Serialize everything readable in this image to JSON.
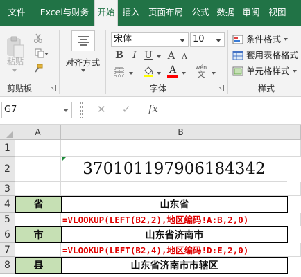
{
  "ribbon_tabs": [
    "文件",
    "Excel与财务",
    "开始",
    "插入",
    "页面布局",
    "公式",
    "数据",
    "审阅",
    "视图"
  ],
  "active_tab": "开始",
  "clipboard": {
    "paste_label": "粘贴",
    "group_label": "剪贴板"
  },
  "alignment": {
    "label": "对齐方式"
  },
  "font": {
    "name": "宋体",
    "size": "10",
    "group_label": "字体",
    "bold": "B",
    "italic": "I",
    "underline": "U",
    "grow": "A",
    "shrink": "A",
    "color_a": "A",
    "phonetic": "wén"
  },
  "styles": {
    "conditional_format": "条件格式",
    "table_format": "套用表格格式",
    "cell_style": "单元格样式",
    "group_label": "样式"
  },
  "colors": {
    "brand": "#217346",
    "highlight": "#ffff00",
    "font_color": "#ff0000",
    "label_fill": "#c6e0b4",
    "formula_text": "#e00000"
  },
  "formula_bar": {
    "name_box": "G7",
    "cancel_icon": "✕",
    "enter_icon": "✓",
    "fx": "fx",
    "content": ""
  },
  "sheet": {
    "columns": [
      "A",
      "B"
    ],
    "rows": [
      "1",
      "2",
      "3",
      "4",
      "5",
      "6",
      "7",
      "8"
    ],
    "id_number": "370101197906184342",
    "province_label": "省",
    "province_value": "山东省",
    "province_formula": "=VLOOKUP(LEFT(B2,2),地区编码!A:B,2,0)",
    "city_label": "市",
    "city_value": "山东省济南市",
    "city_formula": "=VLOOKUP(LEFT(B2,4),地区编码!D:E,2,0)",
    "county_label": "县",
    "county_value": "山东省济南市市辖区"
  }
}
